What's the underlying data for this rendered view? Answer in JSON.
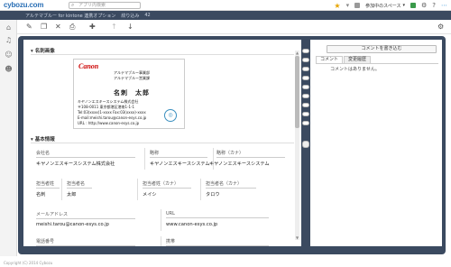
{
  "header": {
    "logo": "cybozu.com",
    "search_placeholder": "アプリ内検索",
    "space_label": "参加中のスペース"
  },
  "subbar": {
    "breadcrumbs": [
      "アルテマブルー for kintone 連携オプション",
      "絞り込み",
      "42"
    ]
  },
  "toolbar": {
    "buttons": [
      "edit-icon",
      "copy-icon",
      "delete-icon",
      "print-icon",
      "add-icon",
      "prev-icon",
      "next-icon",
      "settings-icon"
    ]
  },
  "form": {
    "card_section": "名刺画像",
    "basic_section": "基本情報",
    "business_card": {
      "brand": "Canon",
      "dept1": "アルテマブルー事業部",
      "dept2": "アルテマブルー営業課",
      "name": "名刺　太郎",
      "company": "キヤノンエスキースシステム株式会社",
      "address": "〒108-0011 東京都港区港南1-1-1",
      "tel": "Tel:03(xxxx)1-xxxx  Fax:03(xxxx)-xxxx",
      "email": "E-mail:meishi.tarou@canon-esys.co.jp",
      "url": "URL : http://www.canon-esys.co.jp"
    },
    "fields": {
      "company_label": "会社名",
      "company_value": "キヤノンエスキースシステム株式会社",
      "short_label": "略称",
      "short_value": "キヤノンエスキースシステム",
      "short_kana_label": "略称（カナ）",
      "short_kana_value": "キヤノンエスキースシステム",
      "last_name_label": "担当者姓",
      "last_name_value": "名刺",
      "first_name_label": "担当者名",
      "first_name_value": "太郎",
      "last_kana_label": "担当者姓（カナ）",
      "last_kana_value": "メイシ",
      "first_kana_label": "担当者名（カナ）",
      "first_kana_value": "タロウ",
      "email_label": "メールアドレス",
      "email_value": "meishi.tarou@canon-esys.co.jp",
      "url_label": "URL",
      "url_value": "www.canon-esys.co.jp",
      "phone_label": "電話番号",
      "mobile_label": "携帯"
    }
  },
  "comments": {
    "write_button": "コメントを書き込む",
    "tab_comment": "コメント",
    "tab_history": "変更履歴",
    "empty": "コメントはありません。"
  },
  "footer": {
    "copyright": "Copyright (C) 2014 Cybozu"
  }
}
